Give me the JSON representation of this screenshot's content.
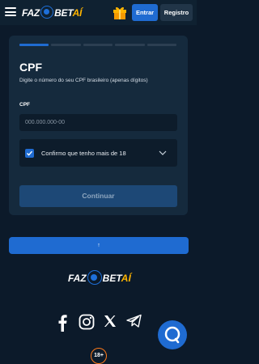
{
  "header": {
    "logo": {
      "part1": "FAZ",
      "part2": "O",
      "part3": "BET",
      "part4": "AÍ"
    },
    "gift_icon": "gift-icon",
    "login_label": "Entrar",
    "register_label": "Registro"
  },
  "form": {
    "step_count": 5,
    "active_step": 1,
    "title": "CPF",
    "subtitle": "Digite o número do seu CPF brasileiro (apenas dígitos)",
    "cpf_label": "CPF",
    "cpf_placeholder": "000.000.000-00",
    "cpf_value": "",
    "age_confirm_label": "Confirmo que tenho mais de 18",
    "age_confirm_checked": true,
    "continue_label": "Continuar"
  },
  "scroll_top_label": "↑",
  "footer": {
    "logo": {
      "part1": "FAZ",
      "part2": "O",
      "part3": "BET",
      "part4": "AÍ"
    },
    "social_icons": [
      "facebook-icon",
      "instagram-icon",
      "x-icon",
      "telegram-icon"
    ],
    "age_badge": "18+"
  },
  "colors": {
    "background": "#0c1a2a",
    "card": "#152a3d",
    "accent": "#1f6bd1",
    "logo_orange": "#ffb400",
    "badge_orange": "#ff7a1a"
  }
}
